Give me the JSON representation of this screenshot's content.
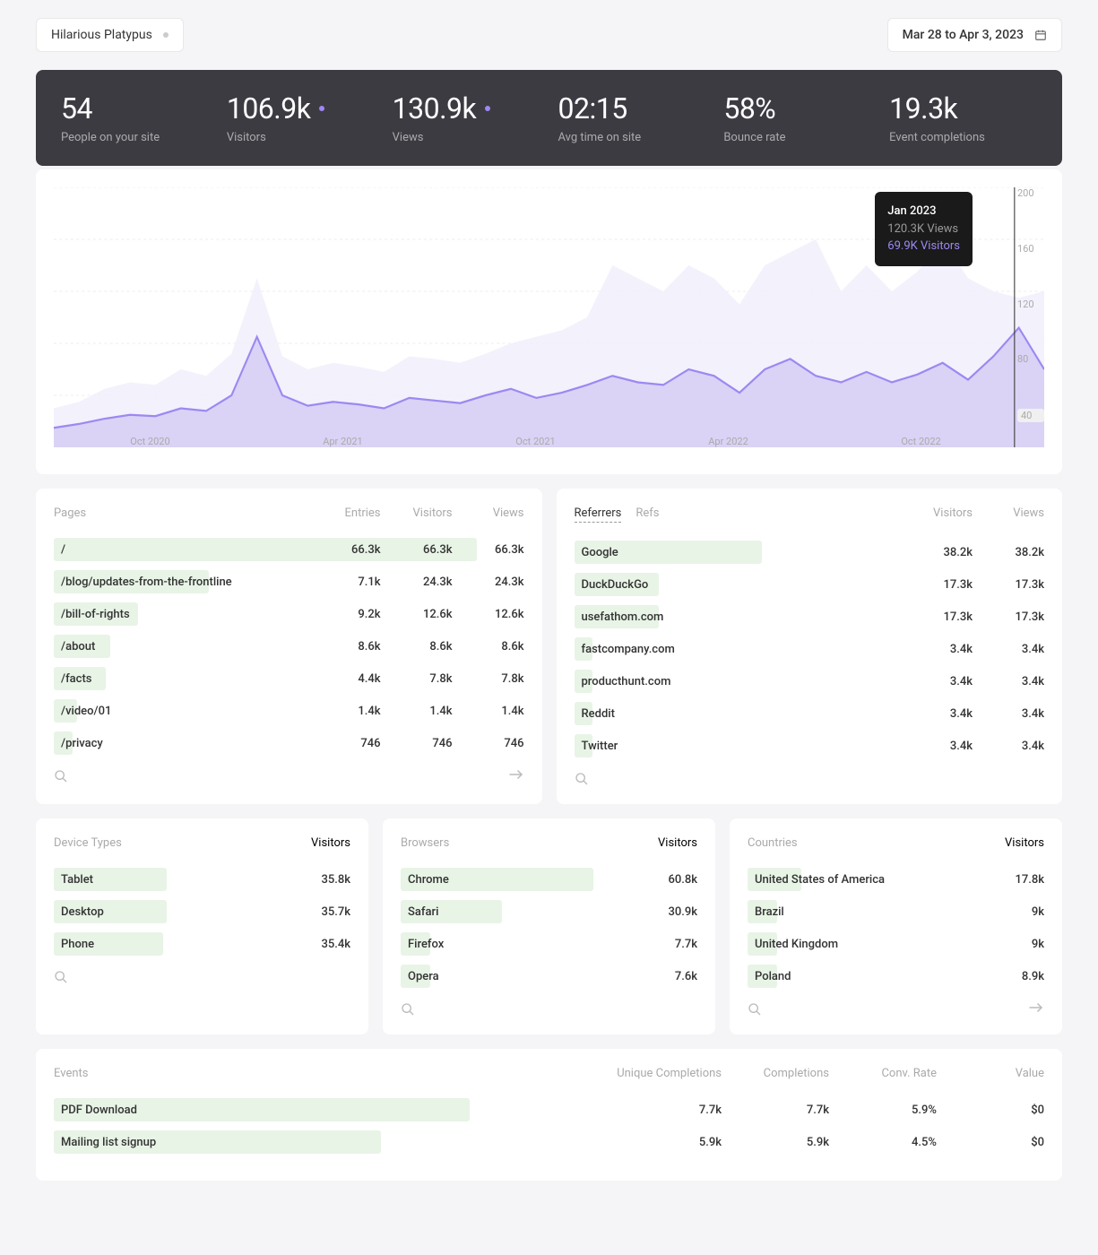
{
  "siteName": "Hilarious Platypus",
  "dateRange": "Mar 28 to Apr 3, 2023",
  "stats": [
    {
      "value": "54",
      "label": "People on your site",
      "dot": false
    },
    {
      "value": "106.9k",
      "label": "Visitors",
      "dot": true
    },
    {
      "value": "130.9k",
      "label": "Views",
      "dot": true
    },
    {
      "value": "02:15",
      "label": "Avg time on site",
      "dot": false
    },
    {
      "value": "58%",
      "label": "Bounce rate",
      "dot": false
    },
    {
      "value": "19.3k",
      "label": "Event completions",
      "dot": false
    }
  ],
  "chart_data": {
    "type": "area",
    "xTicks": [
      "Oct 2020",
      "Apr 2021",
      "Oct 2021",
      "Apr 2022",
      "Oct 2022"
    ],
    "yTicks": [
      "200",
      "160",
      "120",
      "80",
      "40"
    ],
    "ylim": [
      0,
      200
    ],
    "xlabel": "",
    "ylabel": "",
    "tooltip": {
      "title": "Jan 2023",
      "views": "120.3K Views",
      "visitors": "69.9K Visitors"
    },
    "series": [
      {
        "name": "Views",
        "color": "#f0edfa",
        "values": [
          30,
          35,
          45,
          50,
          48,
          60,
          55,
          72,
          130,
          70,
          60,
          65,
          62,
          58,
          70,
          68,
          65,
          72,
          80,
          85,
          90,
          100,
          140,
          130,
          120,
          140,
          130,
          110,
          140,
          150,
          160,
          120,
          140,
          120,
          135,
          160,
          130,
          120,
          115,
          120
        ]
      },
      {
        "name": "Visitors",
        "color": "#9d88f2",
        "values": [
          15,
          18,
          22,
          25,
          24,
          30,
          28,
          40,
          85,
          40,
          32,
          35,
          33,
          30,
          38,
          36,
          34,
          40,
          45,
          38,
          42,
          48,
          55,
          50,
          48,
          60,
          55,
          42,
          60,
          68,
          55,
          50,
          58,
          50,
          56,
          65,
          52,
          70,
          92,
          60
        ]
      }
    ]
  },
  "pages": {
    "title": "Pages",
    "cols": [
      "Entries",
      "Visitors",
      "Views"
    ],
    "rows": [
      {
        "label": "/",
        "vals": [
          "66.3k",
          "66.3k",
          "66.3k"
        ],
        "bar": 90
      },
      {
        "label": "/blog/updates-from-the-frontline",
        "vals": [
          "7.1k",
          "24.3k",
          "24.3k"
        ],
        "bar": 33
      },
      {
        "label": "/bill-of-rights",
        "vals": [
          "9.2k",
          "12.6k",
          "12.6k"
        ],
        "bar": 18
      },
      {
        "label": "/about",
        "vals": [
          "8.6k",
          "8.6k",
          "8.6k"
        ],
        "bar": 12
      },
      {
        "label": "/facts",
        "vals": [
          "4.4k",
          "7.8k",
          "7.8k"
        ],
        "bar": 11
      },
      {
        "label": "/video/01",
        "vals": [
          "1.4k",
          "1.4k",
          "1.4k"
        ],
        "bar": 5
      },
      {
        "label": "/privacy",
        "vals": [
          "746",
          "746",
          "746"
        ],
        "bar": 4
      }
    ]
  },
  "referrers": {
    "tabs": [
      "Referrers",
      "Refs"
    ],
    "cols": [
      "Visitors",
      "Views"
    ],
    "rows": [
      {
        "label": "Google",
        "vals": [
          "38.2k",
          "38.2k"
        ],
        "bar": 40
      },
      {
        "label": "DuckDuckGo",
        "vals": [
          "17.3k",
          "17.3k"
        ],
        "bar": 18
      },
      {
        "label": "usefathom.com",
        "vals": [
          "17.3k",
          "17.3k"
        ],
        "bar": 18
      },
      {
        "label": "fastcompany.com",
        "vals": [
          "3.4k",
          "3.4k"
        ],
        "bar": 4
      },
      {
        "label": "producthunt.com",
        "vals": [
          "3.4k",
          "3.4k"
        ],
        "bar": 4
      },
      {
        "label": "Reddit",
        "vals": [
          "3.4k",
          "3.4k"
        ],
        "bar": 4
      },
      {
        "label": "Twitter",
        "vals": [
          "3.4k",
          "3.4k"
        ],
        "bar": 4
      }
    ]
  },
  "devices": {
    "title": "Device Types",
    "col": "Visitors",
    "rows": [
      {
        "label": "Tablet",
        "val": "35.8k",
        "bar": 38
      },
      {
        "label": "Desktop",
        "val": "35.7k",
        "bar": 38
      },
      {
        "label": "Phone",
        "val": "35.4k",
        "bar": 37
      }
    ]
  },
  "browsers": {
    "title": "Browsers",
    "col": "Visitors",
    "rows": [
      {
        "label": "Chrome",
        "val": "60.8k",
        "bar": 65
      },
      {
        "label": "Safari",
        "val": "30.9k",
        "bar": 34
      },
      {
        "label": "Firefox",
        "val": "7.7k",
        "bar": 10
      },
      {
        "label": "Opera",
        "val": "7.6k",
        "bar": 10
      }
    ]
  },
  "countries": {
    "title": "Countries",
    "col": "Visitors",
    "rows": [
      {
        "label": "United States of America",
        "val": "17.8k",
        "bar": 18
      },
      {
        "label": "Brazil",
        "val": "9k",
        "bar": 10
      },
      {
        "label": "United Kingdom",
        "val": "9k",
        "bar": 10
      },
      {
        "label": "Poland",
        "val": "8.9k",
        "bar": 10
      }
    ]
  },
  "events": {
    "title": "Events",
    "cols": [
      "Unique Completions",
      "Completions",
      "Conv. Rate",
      "Value"
    ],
    "rows": [
      {
        "label": "PDF Download",
        "vals": [
          "7.7k",
          "7.7k",
          "5.9%",
          "$0"
        ],
        "bar": 42
      },
      {
        "label": "Mailing list signup",
        "vals": [
          "5.9k",
          "5.9k",
          "4.5%",
          "$0"
        ],
        "bar": 33
      }
    ]
  }
}
